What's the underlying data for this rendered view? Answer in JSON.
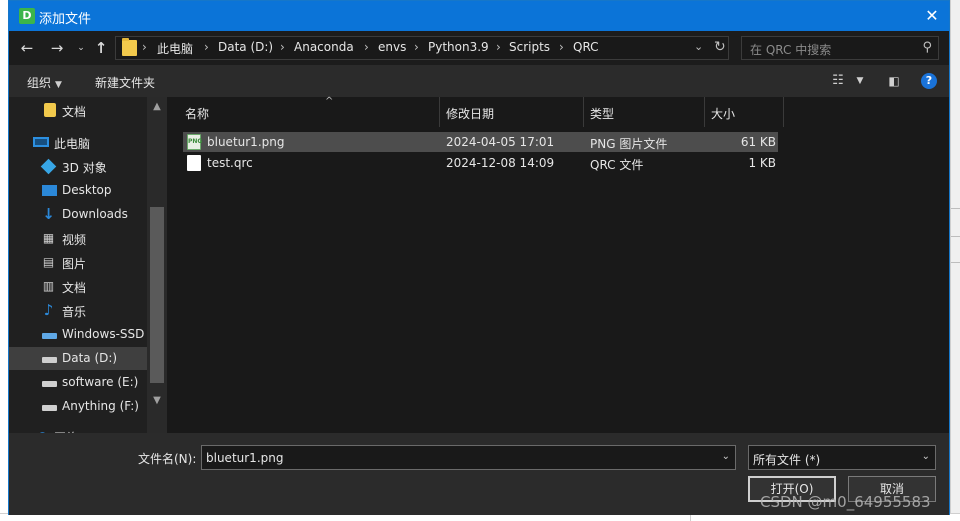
{
  "window": {
    "title": "添加文件",
    "app_icon_letter": "D",
    "close_glyph": "✕"
  },
  "nav": {
    "breadcrumbs": [
      "此电脑",
      "Data (D:)",
      "Anaconda",
      "envs",
      "Python3.9",
      "Scripts",
      "QRC"
    ],
    "separator": "›",
    "search_placeholder": "在 QRC 中搜索"
  },
  "toolbar": {
    "organize_label": "组织",
    "new_folder_label": "新建文件夹"
  },
  "sidebar": {
    "items": [
      {
        "label": "文档",
        "icon": "folder-icon"
      },
      {
        "label": "此电脑",
        "icon": "pc-icon"
      },
      {
        "label": "3D 对象",
        "icon": "3d-objects-icon"
      },
      {
        "label": "Desktop",
        "icon": "desktop-icon"
      },
      {
        "label": "Downloads",
        "icon": "download-icon"
      },
      {
        "label": "视频",
        "icon": "video-icon"
      },
      {
        "label": "图片",
        "icon": "pictures-icon"
      },
      {
        "label": "文档",
        "icon": "documents-icon"
      },
      {
        "label": "音乐",
        "icon": "music-icon"
      },
      {
        "label": "Windows-SSD",
        "icon": "windows-drive-icon"
      },
      {
        "label": "Data (D:)",
        "icon": "drive-icon"
      },
      {
        "label": "software (E:)",
        "icon": "drive-icon"
      },
      {
        "label": "Anything (F:)",
        "icon": "drive-icon"
      },
      {
        "label": "网络",
        "icon": "network-icon"
      }
    ],
    "selected_index": 10
  },
  "file_list": {
    "columns": [
      "名称",
      "修改日期",
      "类型",
      "大小"
    ],
    "rows": [
      {
        "name": "bluetur1.png",
        "modified": "2024-04-05 17:01",
        "type": "PNG 图片文件",
        "size": "61 KB",
        "icon": "png-file-icon",
        "selected": true
      },
      {
        "name": "test.qrc",
        "modified": "2024-12-08 14:09",
        "type": "QRC 文件",
        "size": "1 KB",
        "icon": "file-icon",
        "selected": false
      }
    ]
  },
  "bottom": {
    "filename_label": "文件名(N):",
    "filename_value": "bluetur1.png",
    "filetype_value": "所有文件 (*)",
    "open_label": "打开(O)",
    "cancel_label": "取消"
  },
  "watermark": "CSDN @m0_64955583",
  "colors": {
    "titlebar": "#0b74d8",
    "dialog_bg": "#202020",
    "list_bg": "#191919",
    "selection": "#4d4d4d"
  }
}
